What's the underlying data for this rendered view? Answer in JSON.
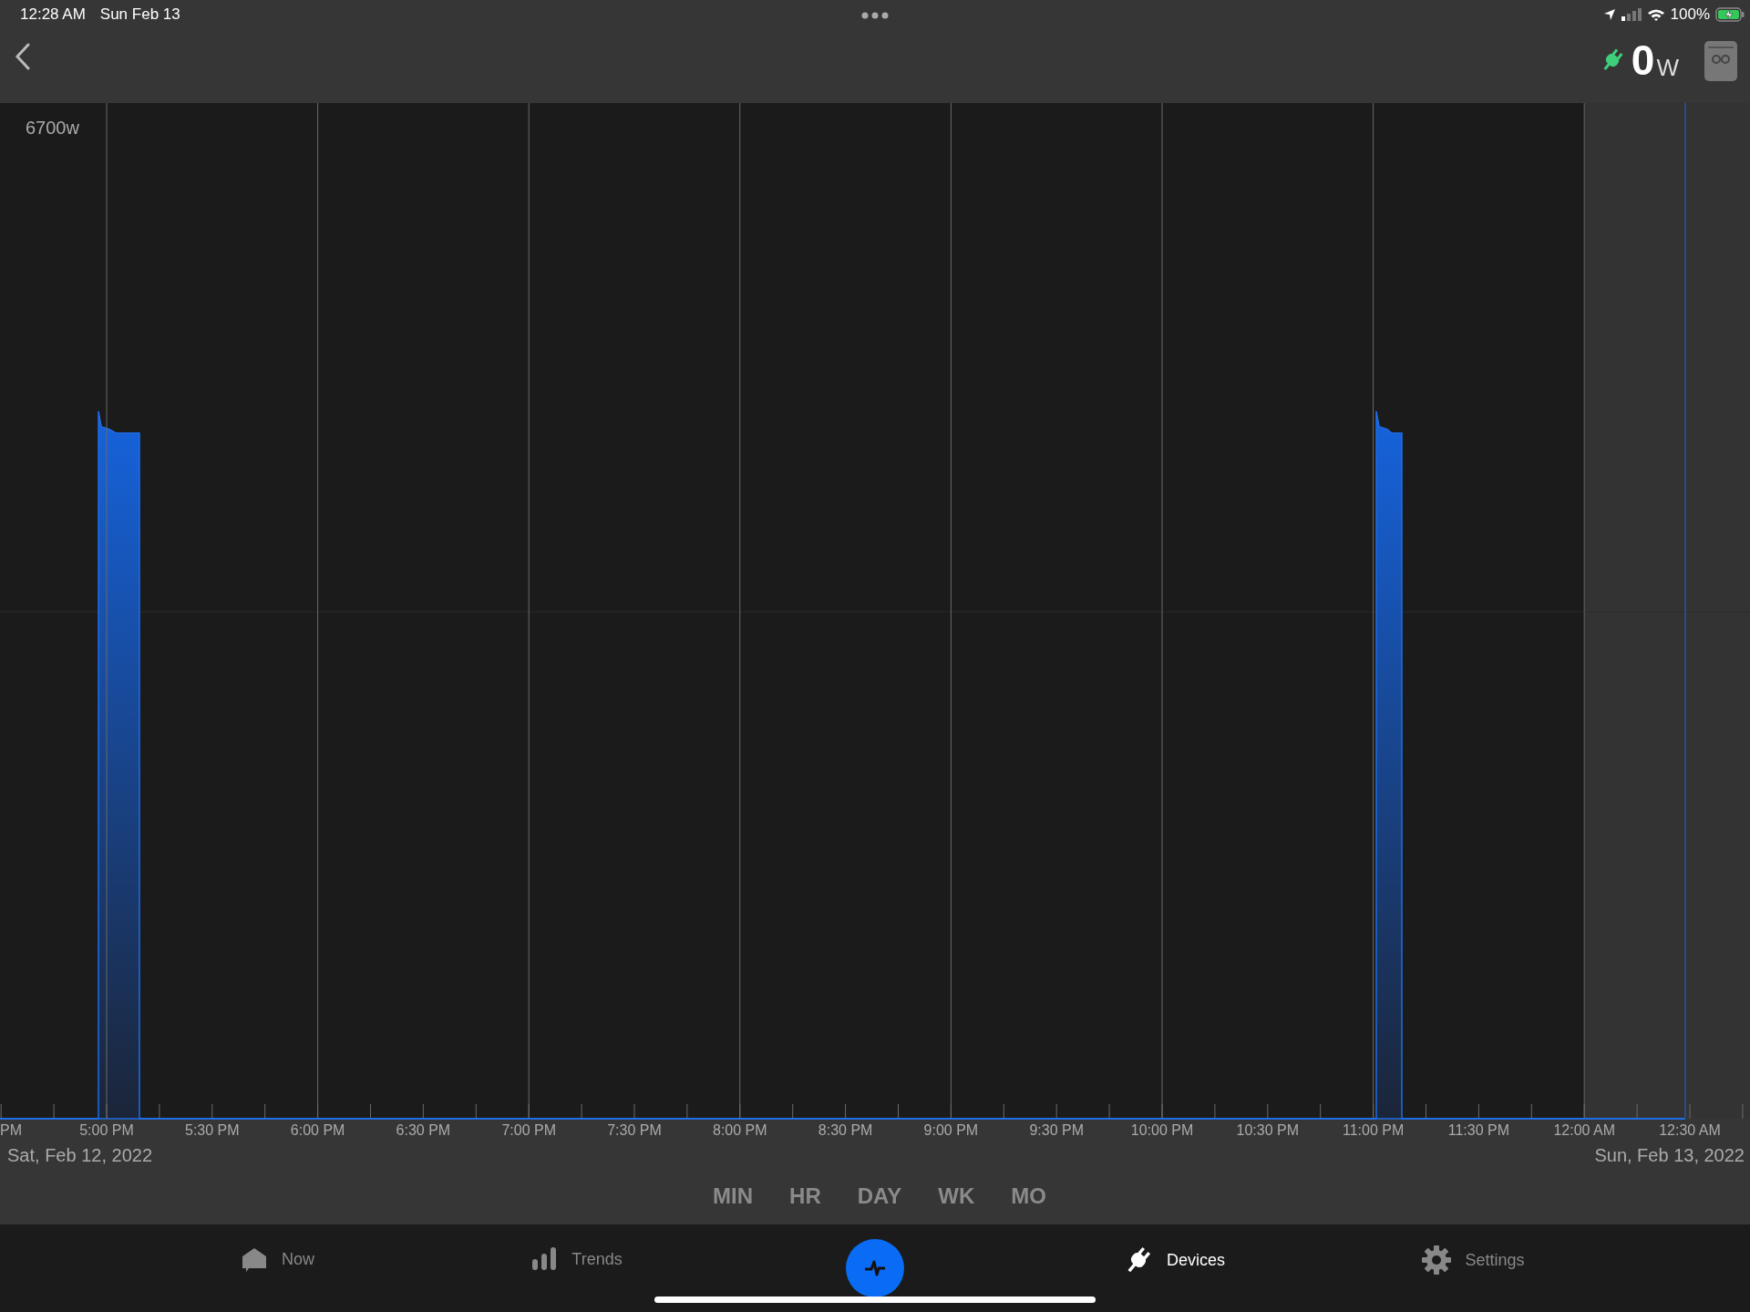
{
  "status_bar": {
    "time": "12:28 AM",
    "date": "Sun Feb 13",
    "battery": "100%"
  },
  "header": {
    "power_value": "0",
    "power_unit": "W"
  },
  "chart": {
    "y_label": "6700w",
    "start_date": "Sat, Feb 12, 2022",
    "end_date": "Sun, Feb 13, 2022",
    "x_labels": [
      "PM",
      "5:00 PM",
      "5:30 PM",
      "6:00 PM",
      "6:30 PM",
      "7:00 PM",
      "7:30 PM",
      "8:00 PM",
      "8:30 PM",
      "9:00 PM",
      "9:30 PM",
      "10:00 PM",
      "10:30 PM",
      "11:00 PM",
      "11:30 PM",
      "12:00 AM",
      "12:30 AM"
    ]
  },
  "ranges": [
    {
      "label": "MIN",
      "selected": false
    },
    {
      "label": "HR",
      "selected": false
    },
    {
      "label": "DAY",
      "selected": false
    },
    {
      "label": "WK",
      "selected": false
    },
    {
      "label": "MO",
      "selected": false
    }
  ],
  "nav": [
    {
      "label": "Now",
      "kind": "home",
      "selected": false
    },
    {
      "label": "Trends",
      "kind": "trends",
      "selected": false
    },
    {
      "kind": "pulse",
      "selected": false
    },
    {
      "label": "Devices",
      "kind": "plug",
      "selected": true
    },
    {
      "label": "Settings",
      "kind": "gear",
      "selected": false
    }
  ]
}
